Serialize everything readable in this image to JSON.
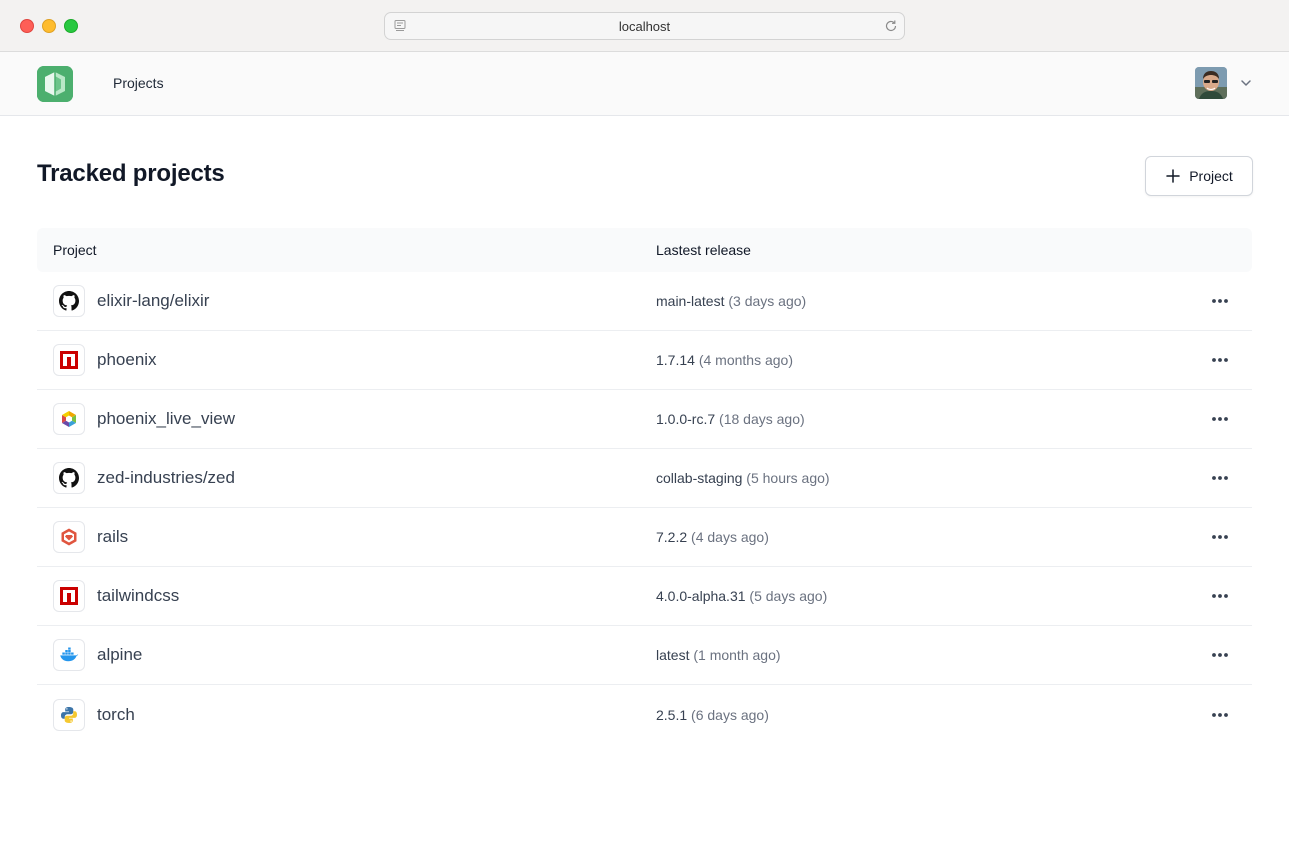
{
  "browser": {
    "url": "localhost"
  },
  "header": {
    "nav_projects": "Projects"
  },
  "page": {
    "title": "Tracked projects",
    "add_button_label": "Project"
  },
  "table": {
    "columns": {
      "project": "Project",
      "release": "Lastest release"
    },
    "rows": [
      {
        "name": "elixir-lang/elixir",
        "release": "main-latest",
        "ago": "(3 days ago)",
        "icon": "github-icon"
      },
      {
        "name": "phoenix",
        "release": "1.7.14",
        "ago": "(4 months ago)",
        "icon": "npm-icon"
      },
      {
        "name": "phoenix_live_view",
        "release": "1.0.0-rc.7",
        "ago": "(18 days ago)",
        "icon": "hex-icon"
      },
      {
        "name": "zed-industries/zed",
        "release": "collab-staging",
        "ago": "(5 hours ago)",
        "icon": "github-icon"
      },
      {
        "name": "rails",
        "release": "7.2.2",
        "ago": "(4 days ago)",
        "icon": "rubygems-icon"
      },
      {
        "name": "tailwindcss",
        "release": "4.0.0-alpha.31",
        "ago": "(5 days ago)",
        "icon": "npm-icon"
      },
      {
        "name": "alpine",
        "release": "latest",
        "ago": "(1 month ago)",
        "icon": "docker-icon"
      },
      {
        "name": "torch",
        "release": "2.5.1",
        "ago": "(6 days ago)",
        "icon": "python-icon"
      }
    ]
  },
  "colors": {
    "logo_green": "#4caf6e",
    "npm_red": "#cb0000",
    "rubygems_red": "#e0553f",
    "docker_blue": "#2496ed"
  }
}
